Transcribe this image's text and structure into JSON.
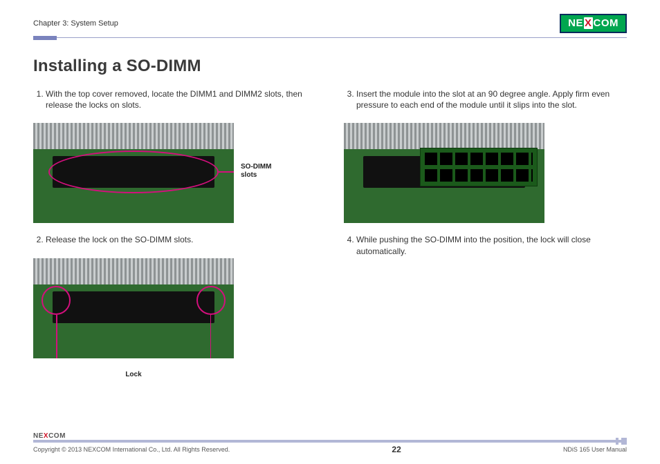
{
  "header": {
    "chapter": "Chapter 3: System Setup",
    "brand_left": "NE",
    "brand_x": "X",
    "brand_right": "COM"
  },
  "title": "Installing a SO-DIMM",
  "left_steps": [
    "With the top cover removed, locate the DIMM1 and DIMM2 slots, then release the locks on slots.",
    "Release the lock on the SO-DIMM slots."
  ],
  "right_steps": [
    "Insert the module into the slot at an 90 degree angle. Apply firm even pressure to each end of the module until it slips into the slot.",
    "While pushing the SO-DIMM into the position, the lock will close automatically."
  ],
  "callouts": {
    "sodimm_slots_l1": "SO-DIMM",
    "sodimm_slots_l2": "slots",
    "lock": "Lock"
  },
  "footer": {
    "brand_left": "NE",
    "brand_x": "X",
    "brand_right": "COM",
    "copyright": "Copyright © 2013 NEXCOM International Co., Ltd. All Rights Reserved.",
    "page_number": "22",
    "doc_title": "NDiS 165 User Manual"
  }
}
